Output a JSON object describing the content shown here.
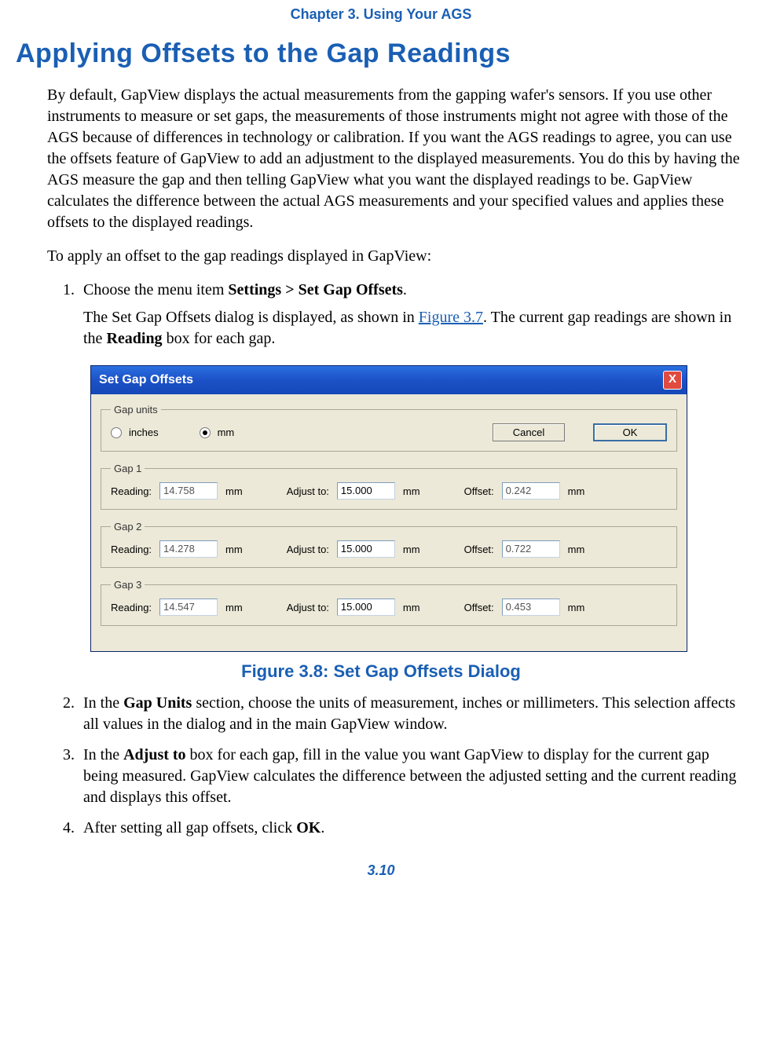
{
  "chapter": "Chapter 3. Using Your AGS",
  "title": "Applying Offsets to the Gap Readings",
  "intro": "By default, GapView displays the actual measurements from the gapping wafer's sensors. If you use other instruments to measure or set gaps, the measurements of those instruments might not agree with those of the AGS because of differences in technology or calibration. If you want the AGS readings to agree, you can use the offsets feature of GapView to add an adjustment to the displayed measurements. You do this by having the AGS measure the gap and then telling GapView what you want the displayed readings to be. GapView calculates the difference between the actual AGS measurements and your specified values and applies these offsets to the displayed readings.",
  "lead_in": "To apply an offset to the gap readings displayed in GapView:",
  "step1_a": "Choose the menu item ",
  "step1_menu": "Settings > Set Gap Offsets",
  "step1_b": ".",
  "step1_sub_a": "The Set Gap Offsets dialog is displayed, as shown in ",
  "step1_fig": "Figure 3.7",
  "step1_sub_b": ". The current gap readings are shown in the ",
  "step1_reading": "Reading",
  "step1_sub_c": " box for each gap.",
  "dialog": {
    "title": "Set Gap Offsets",
    "close": "X",
    "units_legend": "Gap units",
    "inches": "inches",
    "mm": "mm",
    "cancel": "Cancel",
    "ok": "OK",
    "reading_lbl": "Reading:",
    "adjust_lbl": "Adjust to:",
    "offset_lbl": "Offset:",
    "unit": "mm",
    "gap1": {
      "legend": "Gap 1",
      "reading": "14.758",
      "adjust": "15.000",
      "offset": "0.242"
    },
    "gap2": {
      "legend": "Gap 2",
      "reading": "14.278",
      "adjust": "15.000",
      "offset": "0.722"
    },
    "gap3": {
      "legend": "Gap 3",
      "reading": "14.547",
      "adjust": "15.000",
      "offset": "0.453"
    }
  },
  "figure_caption": "Figure 3.8: Set Gap Offsets Dialog",
  "step2_a": "In the ",
  "step2_b": "Gap Units",
  "step2_c": " section, choose the units of measurement, inches or millimeters. This selection affects all values in the dialog and in the main GapView window.",
  "step3_a": "In the ",
  "step3_b": "Adjust to",
  "step3_c": " box for each gap, fill in the value you want GapView to display for the current gap being measured. GapView calculates the difference between the adjusted setting and the current reading and displays this offset.",
  "step4_a": "After setting all gap offsets, click ",
  "step4_b": "OK",
  "step4_c": ".",
  "page_number": "3.10"
}
